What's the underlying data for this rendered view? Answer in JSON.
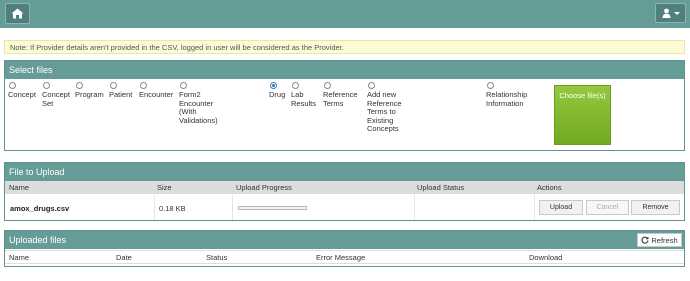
{
  "note": "Note: If Provider details aren't provided in the CSV, logged in user will be considered as the Provider.",
  "select_files": {
    "title": "Select files",
    "options": [
      {
        "label": "Concept",
        "checked": false
      },
      {
        "label": "Concept Set",
        "checked": false
      },
      {
        "label": "Program",
        "checked": false
      },
      {
        "label": "Patient",
        "checked": false
      },
      {
        "label": "Encounter",
        "checked": false
      },
      {
        "label": "Form2 Encounter (With Validations)",
        "checked": false
      },
      {
        "label": "Drug",
        "checked": true
      },
      {
        "label": "Lab Results",
        "checked": false
      },
      {
        "label": "Reference Terms",
        "checked": false
      },
      {
        "label": "Add new Reference Terms to Existing Concepts",
        "checked": false
      },
      {
        "label": "Relationship Information",
        "checked": false
      }
    ],
    "choose_button": "Choose file(s)"
  },
  "file_to_upload": {
    "title": "File to Upload",
    "columns": [
      "Name",
      "Size",
      "Upload Progress",
      "Upload Status",
      "Actions"
    ],
    "row": {
      "name": "amox_drugs.csv",
      "size": "0.18 KB",
      "progress": 0,
      "status": "",
      "actions": [
        "Upload",
        "Cancel",
        "Remove"
      ]
    }
  },
  "uploaded_files": {
    "title": "Uploaded files",
    "refresh_label": "Refresh",
    "columns": [
      "Name",
      "Date",
      "Status",
      "Error Message",
      "Download"
    ]
  }
}
